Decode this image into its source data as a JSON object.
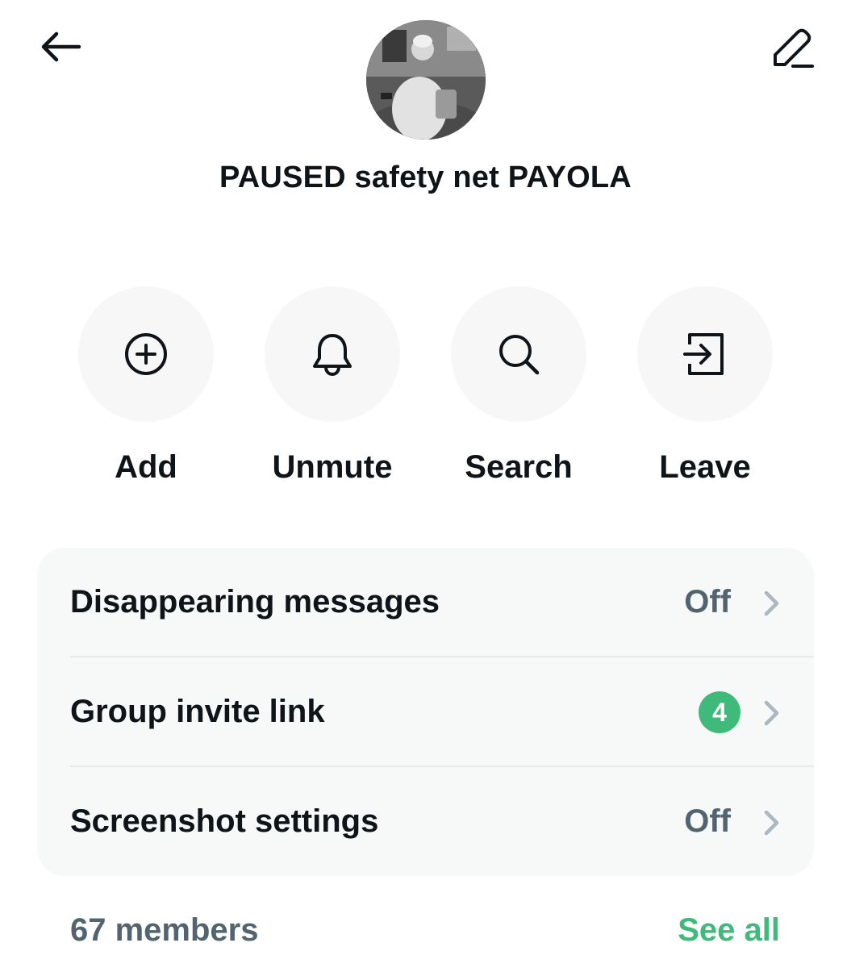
{
  "header": {
    "back_icon": "arrow-left-icon",
    "edit_icon": "pencil-icon",
    "group_name": "PAUSED safety net PAYOLA"
  },
  "actions": [
    {
      "label": "Add",
      "icon": "plus-circle-icon"
    },
    {
      "label": "Unmute",
      "icon": "bell-icon"
    },
    {
      "label": "Search",
      "icon": "search-icon"
    },
    {
      "label": "Leave",
      "icon": "leave-icon"
    }
  ],
  "settings": [
    {
      "title": "Disappearing messages",
      "value": "Off"
    },
    {
      "title": "Group invite link",
      "badge": "4"
    },
    {
      "title": "Screenshot settings",
      "value": "Off"
    }
  ],
  "members": {
    "count_label": "67 members",
    "see_all_label": "See all"
  },
  "colors": {
    "text": "#0f1419",
    "secondary": "#536471",
    "accent_green": "#3fba7a",
    "card_bg": "#f7f8f8"
  }
}
